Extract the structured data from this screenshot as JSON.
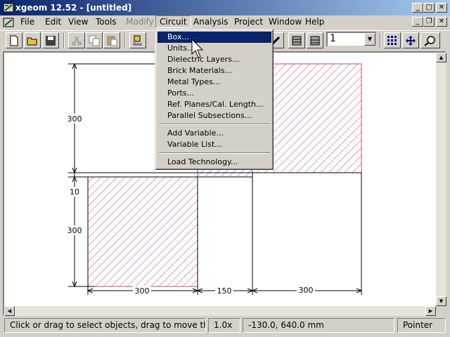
{
  "window": {
    "title": "xgeom 12.52 - [untitled]"
  },
  "menubar": [
    "File",
    "Edit",
    "View",
    "Tools",
    "Modify",
    "Circuit",
    "Analysis",
    "Project",
    "Window",
    "Help"
  ],
  "toolbar": {
    "level_value": "1"
  },
  "circuit_menu": {
    "items": [
      "Box...",
      "Units...",
      "Dielectric Layers...",
      "Brick Materials...",
      "Metal Types...",
      "Ports...",
      "Ref. Planes/Cal. Length...",
      "Parallel Subsections..."
    ],
    "items2": [
      "Add Variable...",
      "Variable List..."
    ],
    "items3": [
      "Load Technology..."
    ]
  },
  "drawing": {
    "dims": [
      "300",
      "10",
      "300",
      "300",
      "150",
      "300"
    ],
    "hatch_color": "#c0487a"
  },
  "status": {
    "message": "Click or drag to select objects, drag to move them",
    "zoom": "1.0x",
    "coords": "-130.0, 640.0 mm",
    "mode": "Pointer"
  },
  "icons": [
    "app-icon",
    "new-file-icon",
    "open-folder-icon",
    "save-icon",
    "cut-icon",
    "copy-icon",
    "paste-icon",
    "new-object-icon",
    "pencil-icon",
    "level-up-icon",
    "level-down-icon",
    "grid-snap-icon",
    "pan-icon",
    "zoom-icon",
    "pointer-cursor-icon"
  ]
}
